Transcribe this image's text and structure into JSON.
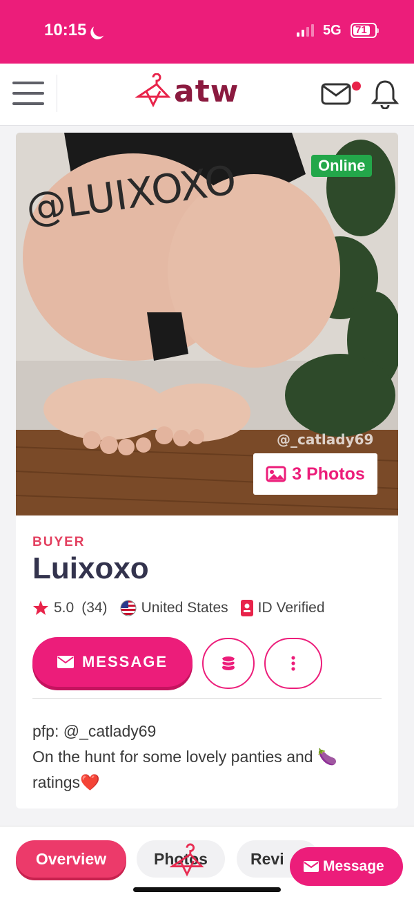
{
  "status_bar": {
    "time": "10:15",
    "network": "5G",
    "battery": "71"
  },
  "header": {
    "logo_text": "atw",
    "has_notification": true
  },
  "profile": {
    "online_label": "Online",
    "watermark": "@_catlady69",
    "photos_label": "3 Photos",
    "photo_text": "@LUIXOXO",
    "role": "BUYER",
    "name": "Luixoxo",
    "rating": "5.0",
    "rating_count": "(34)",
    "country": "United States",
    "verified": "ID Verified",
    "message_label": "MESSAGE",
    "bio_line1": "pfp: @_catlady69",
    "bio_line2": "On the hunt for some lovely panties and 🍆",
    "bio_line3": "ratings❤️"
  },
  "tabs": [
    {
      "label": "Overview",
      "active": true
    },
    {
      "label": "Photos",
      "active": false
    },
    {
      "label": "Revi",
      "active": false
    }
  ],
  "floating_message_label": "Message",
  "colors": {
    "brand_pink": "#ec1d7a",
    "logo_maroon": "#8b1a3f",
    "online_green": "#23a74a"
  }
}
